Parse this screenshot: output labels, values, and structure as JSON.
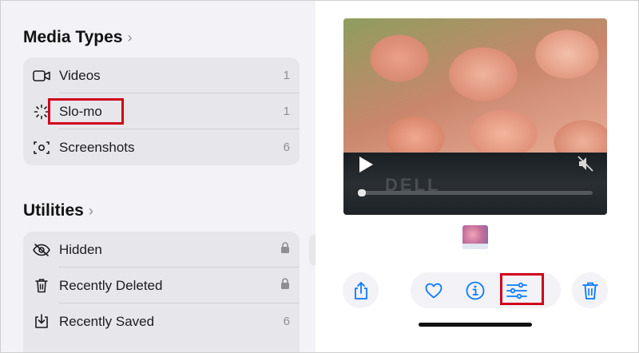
{
  "media_types": {
    "title": "Media Types",
    "items": [
      {
        "label": "Videos",
        "count": "1",
        "icon": "video-camera-icon"
      },
      {
        "label": "Slo-mo",
        "count": "1",
        "icon": "slo-mo-icon"
      },
      {
        "label": "Screenshots",
        "count": "6",
        "icon": "screenshot-icon"
      }
    ]
  },
  "utilities": {
    "title": "Utilities",
    "items": [
      {
        "label": "Hidden",
        "count": "",
        "icon": "eye-slash-icon",
        "locked": true
      },
      {
        "label": "Recently Deleted",
        "count": "",
        "icon": "trash-icon",
        "locked": true
      },
      {
        "label": "Recently Saved",
        "count": "6",
        "icon": "download-tray-icon",
        "locked": false
      }
    ]
  },
  "viewer": {
    "video_watermark": "DELL"
  },
  "toolbar": {
    "share_icon": "share-icon",
    "favorite_icon": "heart-icon",
    "info_icon": "info-icon",
    "edit_icon": "adjustments-sliders-icon",
    "delete_icon": "trash-icon"
  },
  "colors": {
    "accent": "#0a7aff",
    "highlight": "#d0021b",
    "panel_bg": "#f2f2f7",
    "group_bg": "#e6e6eb"
  }
}
